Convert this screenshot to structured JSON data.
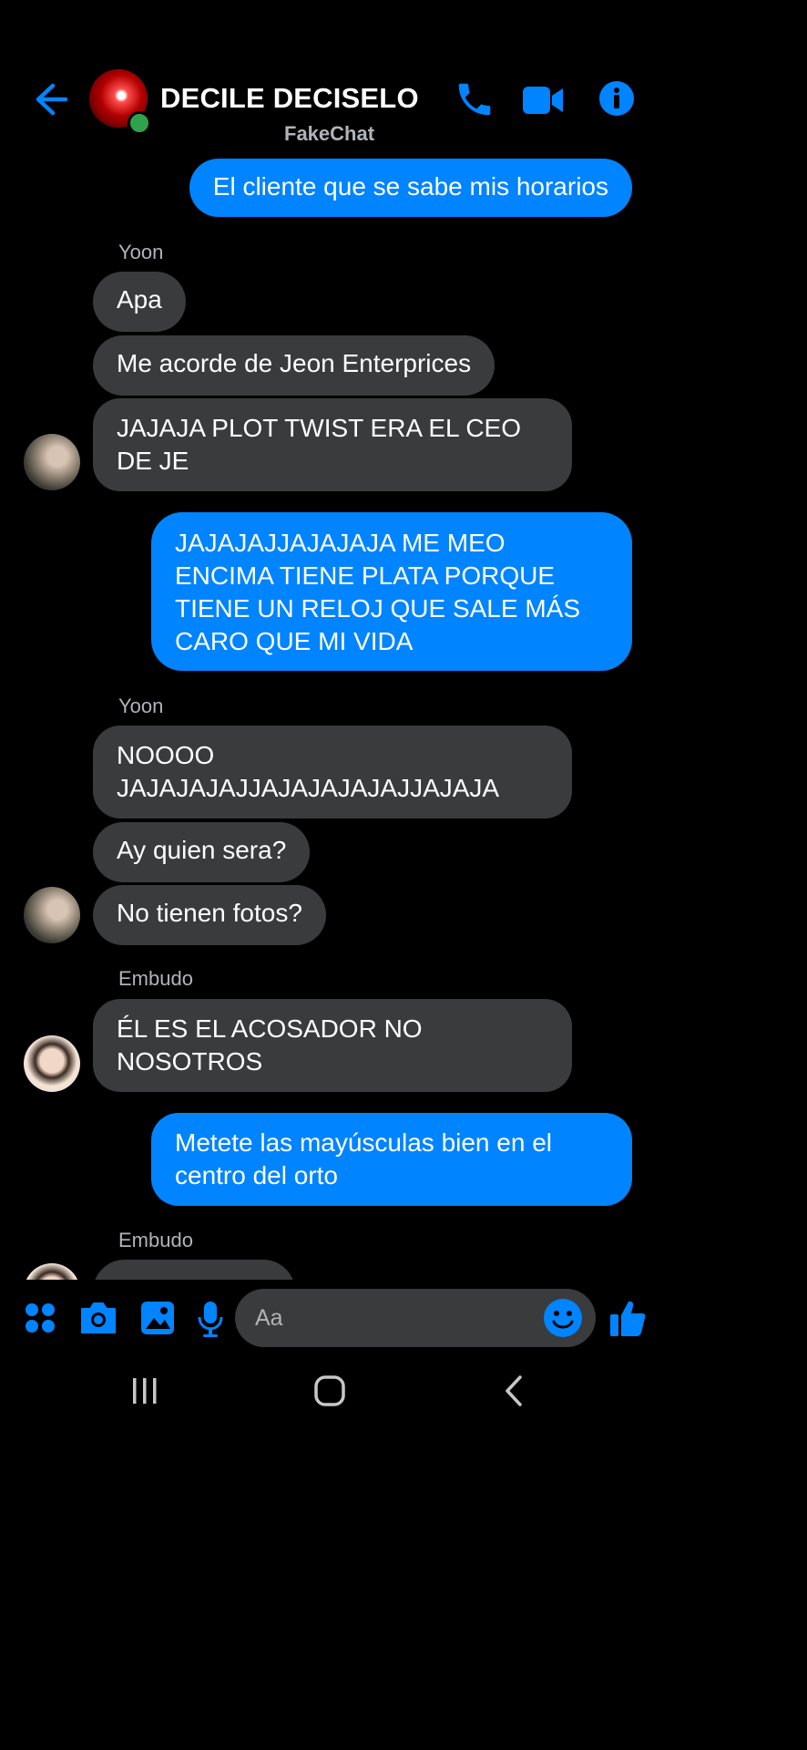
{
  "header": {
    "title": "DECILE DECISELO",
    "subtitle": "FakeChat",
    "icons": [
      "back-arrow-icon",
      "phone-icon",
      "video-camera-icon",
      "info-icon"
    ],
    "accent_color": "#0084ff"
  },
  "messages": [
    {
      "direction": "out",
      "text": "El cliente que se sabe mis horarios"
    },
    {
      "direction": "in",
      "sender": "Yoon",
      "text": "Apa"
    },
    {
      "direction": "in",
      "text": "Me acorde de Jeon Enterprices"
    },
    {
      "direction": "in",
      "text": "JAJAJA PLOT TWIST ERA EL CEO DE JE"
    },
    {
      "direction": "out",
      "text": "JAJAJAJJAJAJAJA ME MEO ENCIMA TIENE PLATA PORQUE TIENE UN RELOJ QUE SALE MÁS CARO QUE MI VIDA"
    },
    {
      "direction": "in",
      "sender": "Yoon",
      "text": "NOOOO JAJAJAJAJJAJAJAJAJAJJAJAJA"
    },
    {
      "direction": "in",
      "text": "Ay quien sera?"
    },
    {
      "direction": "in",
      "text": "No tienen fotos?"
    },
    {
      "direction": "in",
      "sender": "Embudo",
      "text": "ÉL ES EL ACOSADOR NO NOSOTROS"
    },
    {
      "direction": "out",
      "text": "Metete las mayúsculas bien en el centro del orto"
    },
    {
      "direction": "in",
      "sender": "Embudo",
      "text": ""
    }
  ],
  "composer": {
    "placeholder": "Aa",
    "icons": [
      "apps-icon",
      "camera-icon",
      "gallery-icon",
      "microphone-icon",
      "emoji-icon",
      "like-icon"
    ]
  },
  "navbar": {
    "icons": [
      "recent-apps-icon",
      "home-icon",
      "back-nav-icon"
    ]
  },
  "colors": {
    "background": "#000000",
    "incoming_bubble": "#3a3b3c",
    "outgoing_bubble": "#0084ff",
    "secondary_text": "#b0b3b8",
    "online": "#31a24c"
  }
}
